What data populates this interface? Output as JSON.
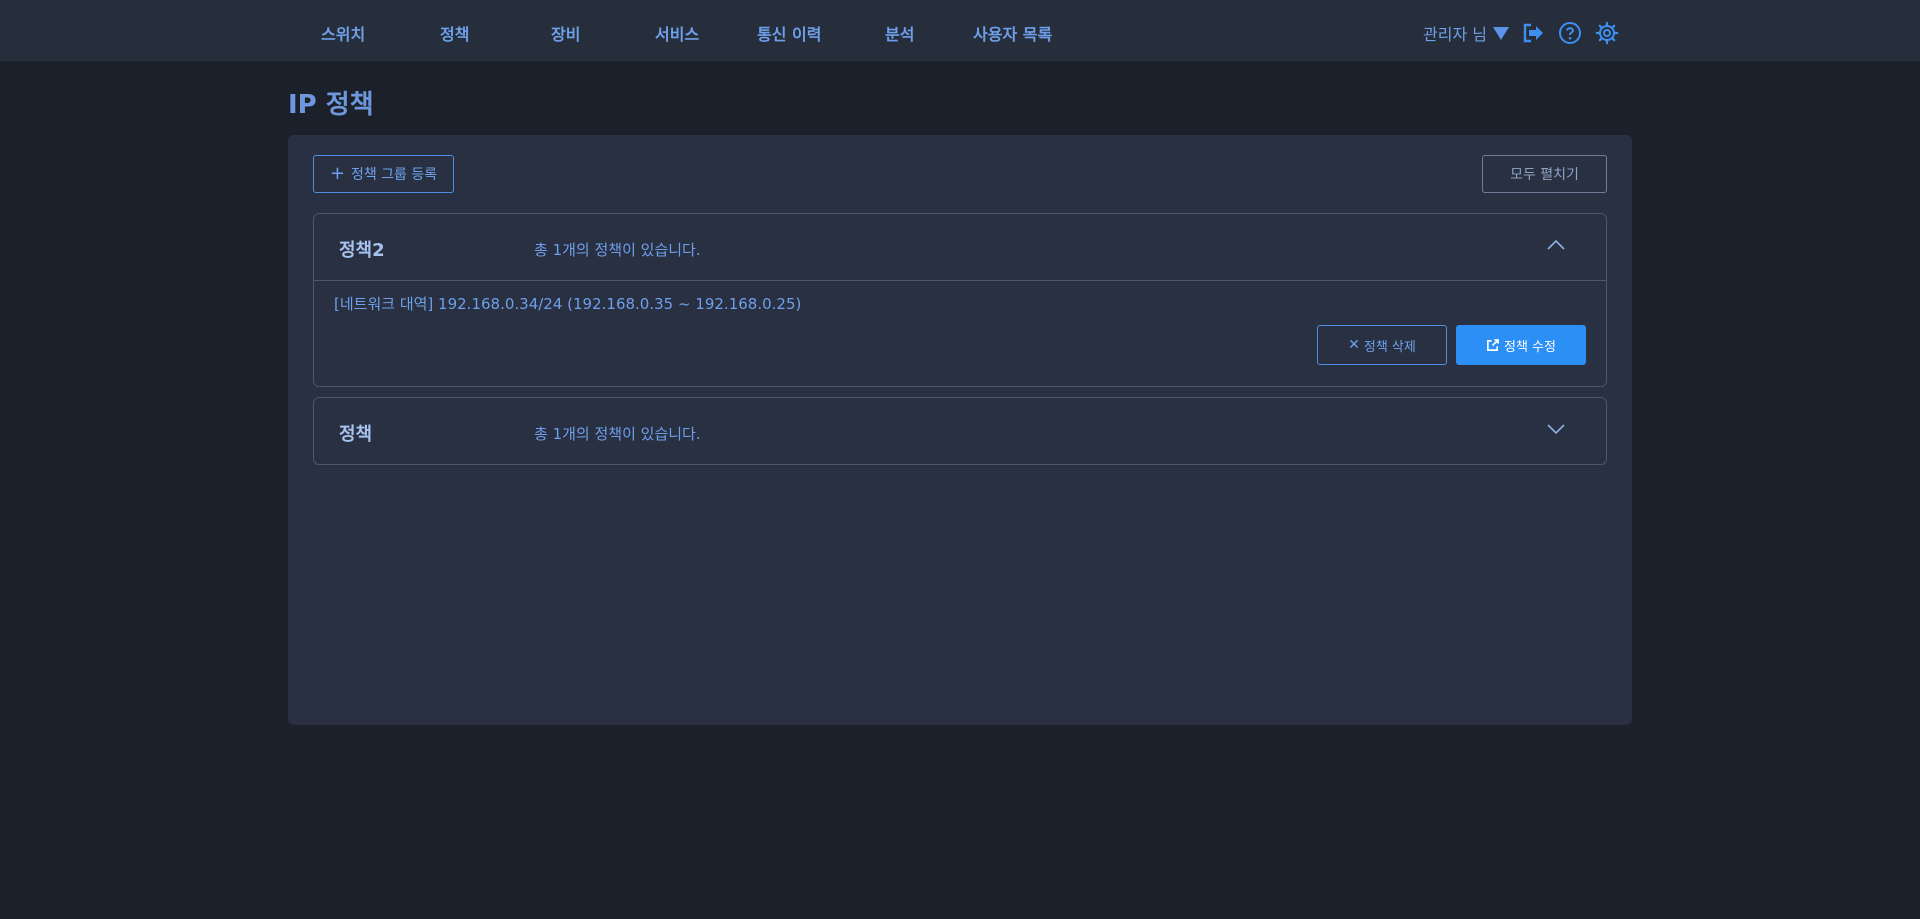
{
  "nav": {
    "items": [
      {
        "label": "스위치"
      },
      {
        "label": "정책"
      },
      {
        "label": "장비"
      },
      {
        "label": "서비스"
      },
      {
        "label": "통신 이력"
      },
      {
        "label": "분석"
      },
      {
        "label": "사용자 목록"
      }
    ],
    "user_label": "관리자 님",
    "icons": [
      "logout-icon",
      "help-icon",
      "settings-icon"
    ]
  },
  "page": {
    "title": "IP 정책"
  },
  "toolbar": {
    "add_group_label": "정책 그룹 등록",
    "expand_all_label": "모두 펼치기"
  },
  "groups": [
    {
      "name": "정책2",
      "count_text": "총 1개의 정책이 있습니다.",
      "expanded": true,
      "policies": [
        {
          "text": "[네트워크 대역] 192.168.0.34/24 (192.168.0.35 ~ 192.168.0.25)",
          "delete_label": "정책 삭제",
          "edit_label": "정책 수정"
        }
      ]
    },
    {
      "name": "정책",
      "count_text": "총 1개의 정책이 있습니다.",
      "expanded": false
    }
  ],
  "colors": {
    "background": "#1b202a",
    "topbar": "#262e3c",
    "panel": "#283041",
    "accent": "#2b8ff5",
    "text": "#6f9fea"
  }
}
